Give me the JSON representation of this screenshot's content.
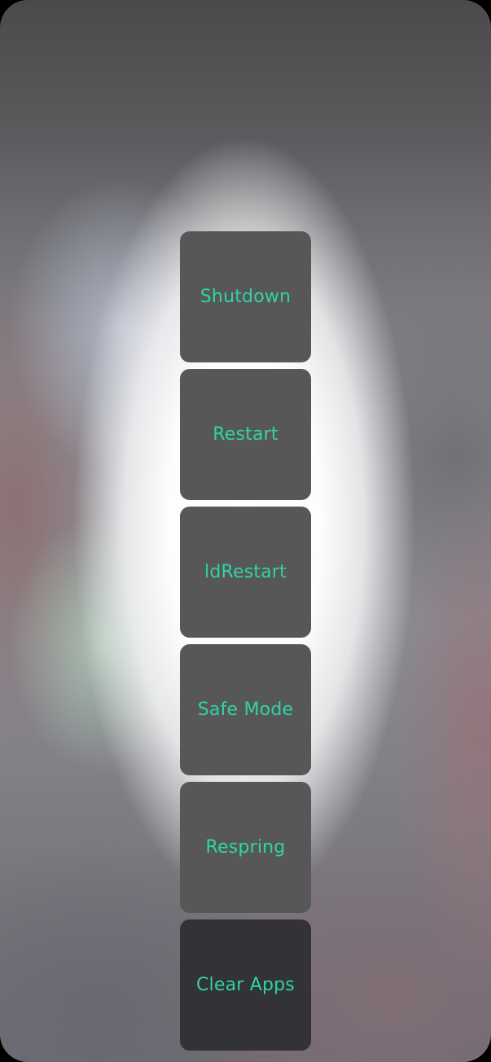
{
  "power_menu": {
    "accent_color": "#2fd4a4",
    "options": [
      {
        "label": "Shutdown"
      },
      {
        "label": "Restart"
      },
      {
        "label": "ldRestart"
      },
      {
        "label": "Safe Mode"
      },
      {
        "label": "Respring"
      },
      {
        "label": "Clear Apps"
      }
    ]
  }
}
